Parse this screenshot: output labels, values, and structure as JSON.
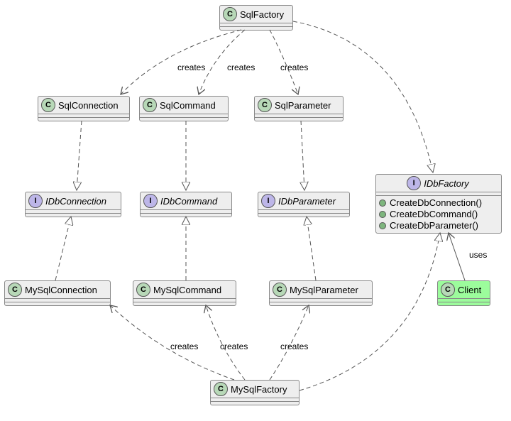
{
  "diagram_type": "uml-class-diagram",
  "nodes": {
    "SqlFactory": {
      "kind": "C",
      "label": "SqlFactory"
    },
    "SqlConnection": {
      "kind": "C",
      "label": "SqlConnection"
    },
    "SqlCommand": {
      "kind": "C",
      "label": "SqlCommand"
    },
    "SqlParameter": {
      "kind": "C",
      "label": "SqlParameter"
    },
    "IDbConnection": {
      "kind": "I",
      "label": "IDbConnection",
      "italic": true
    },
    "IDbCommand": {
      "kind": "I",
      "label": "IDbCommand",
      "italic": true
    },
    "IDbParameter": {
      "kind": "I",
      "label": "IDbParameter",
      "italic": true
    },
    "IDbFactory": {
      "kind": "I",
      "label": "IDbFactory",
      "italic": true,
      "methods": [
        "CreateDbConnection()",
        "CreateDbCommand()",
        "CreateDbParameter()"
      ]
    },
    "MySqlConnection": {
      "kind": "C",
      "label": "MySqlConnection"
    },
    "MySqlCommand": {
      "kind": "C",
      "label": "MySqlCommand"
    },
    "MySqlParameter": {
      "kind": "C",
      "label": "MySqlParameter"
    },
    "MySqlFactory": {
      "kind": "C",
      "label": "MySqlFactory"
    },
    "Client": {
      "kind": "C",
      "label": "Client",
      "highlight": true
    }
  },
  "edges": [
    {
      "from": "SqlFactory",
      "to": "SqlConnection",
      "style": "dashed-open-arrow",
      "label": "creates"
    },
    {
      "from": "SqlFactory",
      "to": "SqlCommand",
      "style": "dashed-open-arrow",
      "label": "creates"
    },
    {
      "from": "SqlFactory",
      "to": "SqlParameter",
      "style": "dashed-open-arrow",
      "label": "creates"
    },
    {
      "from": "SqlFactory",
      "to": "IDbFactory",
      "style": "dashed-triangle"
    },
    {
      "from": "SqlConnection",
      "to": "IDbConnection",
      "style": "dashed-triangle"
    },
    {
      "from": "SqlCommand",
      "to": "IDbCommand",
      "style": "dashed-triangle"
    },
    {
      "from": "SqlParameter",
      "to": "IDbParameter",
      "style": "dashed-triangle"
    },
    {
      "from": "MySqlConnection",
      "to": "IDbConnection",
      "style": "dashed-triangle"
    },
    {
      "from": "MySqlCommand",
      "to": "IDbCommand",
      "style": "dashed-triangle"
    },
    {
      "from": "MySqlParameter",
      "to": "IDbParameter",
      "style": "dashed-triangle"
    },
    {
      "from": "MySqlFactory",
      "to": "MySqlConnection",
      "style": "dashed-open-arrow",
      "label": "creates"
    },
    {
      "from": "MySqlFactory",
      "to": "MySqlCommand",
      "style": "dashed-open-arrow",
      "label": "creates"
    },
    {
      "from": "MySqlFactory",
      "to": "MySqlParameter",
      "style": "dashed-open-arrow",
      "label": "creates"
    },
    {
      "from": "MySqlFactory",
      "to": "IDbFactory",
      "style": "dashed-triangle"
    },
    {
      "from": "Client",
      "to": "IDbFactory",
      "style": "solid-open-arrow",
      "label": "uses"
    }
  ],
  "edge_labels": {
    "creates": "creates",
    "uses": "uses"
  }
}
